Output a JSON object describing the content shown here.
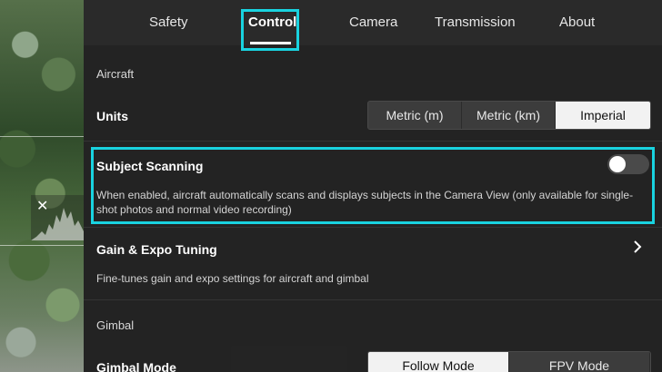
{
  "tabs": [
    {
      "label": "Safety",
      "active": false
    },
    {
      "label": "Control",
      "active": true
    },
    {
      "label": "Camera",
      "active": false
    },
    {
      "label": "Transmission",
      "active": false
    },
    {
      "label": "About",
      "active": false
    }
  ],
  "aircraft": {
    "section_label": "Aircraft",
    "units": {
      "title": "Units",
      "options": [
        "Metric (m)",
        "Metric (km)",
        "Imperial"
      ],
      "selected": "Imperial"
    },
    "subject_scanning": {
      "title": "Subject Scanning",
      "enabled": false,
      "description": "When enabled, aircraft automatically scans and displays subjects in the Camera View (only available for single-shot photos and normal video recording)"
    },
    "gain_expo": {
      "title": "Gain & Expo Tuning",
      "description": "Fine-tunes gain and expo settings for aircraft and gimbal"
    }
  },
  "gimbal": {
    "section_label": "Gimbal",
    "mode": {
      "title": "Gimbal Mode",
      "options": [
        "Follow Mode",
        "FPV Mode"
      ],
      "selected": "Follow Mode"
    }
  },
  "preview": {
    "close_glyph": "✕"
  },
  "colors": {
    "highlight": "#19d3e0",
    "panel_bg": "#242424",
    "selected_segment": "#f2f2f2"
  }
}
